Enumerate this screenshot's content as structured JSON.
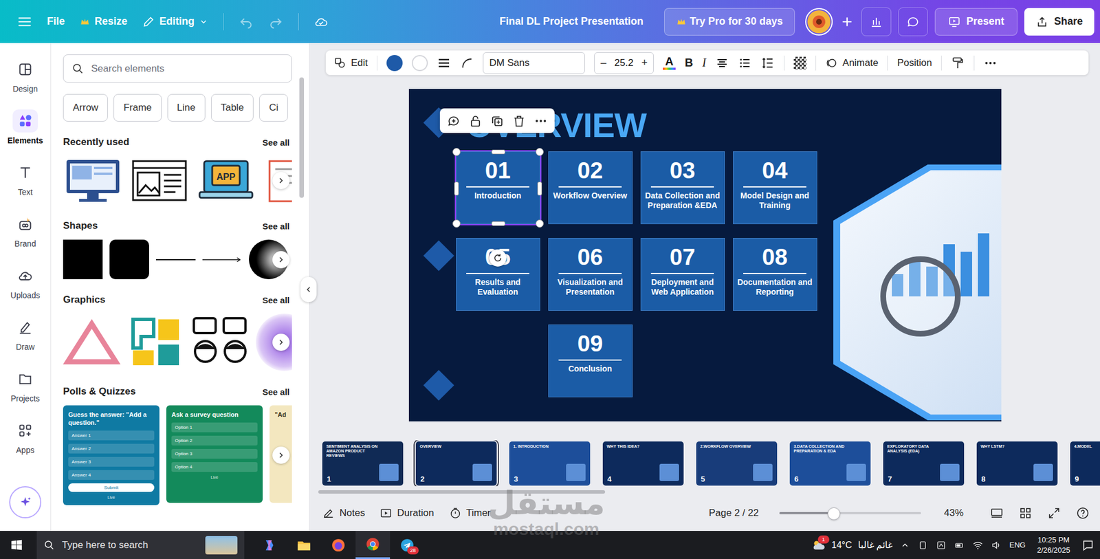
{
  "topbar": {
    "file": "File",
    "resize": "Resize",
    "editing": "Editing",
    "title": "Final DL Project Presentation",
    "pro": "Try Pro for 30 days",
    "present": "Present",
    "share": "Share"
  },
  "sidebar": {
    "items": [
      {
        "label": "Design",
        "selected": false
      },
      {
        "label": "Elements",
        "selected": true
      },
      {
        "label": "Text",
        "selected": false
      },
      {
        "label": "Brand",
        "selected": false
      },
      {
        "label": "Uploads",
        "selected": false
      },
      {
        "label": "Draw",
        "selected": false
      },
      {
        "label": "Projects",
        "selected": false
      },
      {
        "label": "Apps",
        "selected": false
      }
    ]
  },
  "panel": {
    "search_placeholder": "Search elements",
    "chips": [
      "Arrow",
      "Frame",
      "Line",
      "Table",
      "Ci"
    ],
    "see_all": "See all",
    "recent": {
      "title": "Recently used",
      "app_label": "APP"
    },
    "shapes": {
      "title": "Shapes"
    },
    "graphics": {
      "title": "Graphics"
    },
    "polls": {
      "title": "Polls & Quizzes",
      "cards": [
        {
          "title": "Guess the answer: \"Add a question.\"",
          "rows": [
            "Answer 1",
            "Answer 2",
            "Answer 3",
            "Answer 4"
          ],
          "button": "Submit",
          "foot": "Live"
        },
        {
          "title": "Ask a survey question",
          "rows": [
            "Option 1",
            "Option 2",
            "Option 3",
            "Option 4"
          ],
          "button": "",
          "foot": "Live"
        },
        {
          "title": "\"Ad",
          "rows": [],
          "button": "",
          "foot": ""
        }
      ]
    }
  },
  "toolbar": {
    "edit": "Edit",
    "font": "DM Sans",
    "minus": "–",
    "size": "25.2",
    "plus": "+",
    "text_color": "A",
    "bold": "B",
    "italic": "I",
    "animate": "Animate",
    "position": "Position"
  },
  "slide": {
    "title": "OVERVIEW",
    "cards": [
      {
        "number": "01",
        "label": "Introduction",
        "selected": true
      },
      {
        "number": "02",
        "label": "Workflow Overview",
        "selected": false
      },
      {
        "number": "03",
        "label": "Data Collection and Preparation &EDA",
        "selected": false
      },
      {
        "number": "04",
        "label": "Model Design and Training",
        "selected": false
      },
      {
        "number": "05",
        "label": "Results and Evaluation",
        "selected": false
      },
      {
        "number": "06",
        "label": "Visualization and Presentation",
        "selected": false
      },
      {
        "number": "07",
        "label": "Deployment and Web Application",
        "selected": false
      },
      {
        "number": "08",
        "label": "Documentation and Reporting",
        "selected": false
      },
      {
        "number": "09",
        "label": "Conclusion",
        "selected": false
      }
    ]
  },
  "filmstrip": [
    {
      "number": "1",
      "title": "SENTIMENT ANALYSIS ON AMAZON PRODUCT REVIEWS",
      "selected": false
    },
    {
      "number": "2",
      "title": "OVERVIEW",
      "selected": true
    },
    {
      "number": "3",
      "title": "1. INTRODUCTION",
      "selected": false
    },
    {
      "number": "4",
      "title": "WHY THIS IDEA?",
      "selected": false
    },
    {
      "number": "5",
      "title": "2.WORKFLOW OVERVIEW",
      "selected": false
    },
    {
      "number": "6",
      "title": "3.DATA COLLECTION AND PREPARATION & EDA",
      "selected": false
    },
    {
      "number": "7",
      "title": "EXPLORATORY DATA ANALYSIS (EDA)",
      "selected": false
    },
    {
      "number": "8",
      "title": "WHY LSTM?",
      "selected": false
    },
    {
      "number": "9",
      "title": "4.MODEL",
      "selected": false
    }
  ],
  "bottombar": {
    "notes": "Notes",
    "duration": "Duration",
    "timer": "Timer",
    "page": "Page 2 / 22",
    "zoom_level": 0.38,
    "zoom": "43%"
  },
  "taskbar": {
    "search": "Type here to search",
    "telegram_badge": "28",
    "weather_badge": "1",
    "temperature": "14°C",
    "weather": "غائم غالبا",
    "language": "ENG",
    "time": "10:25 PM",
    "date": "2/26/2025"
  },
  "watermark": {
    "arabic": "مستقل",
    "latin": "mostaql.com"
  }
}
